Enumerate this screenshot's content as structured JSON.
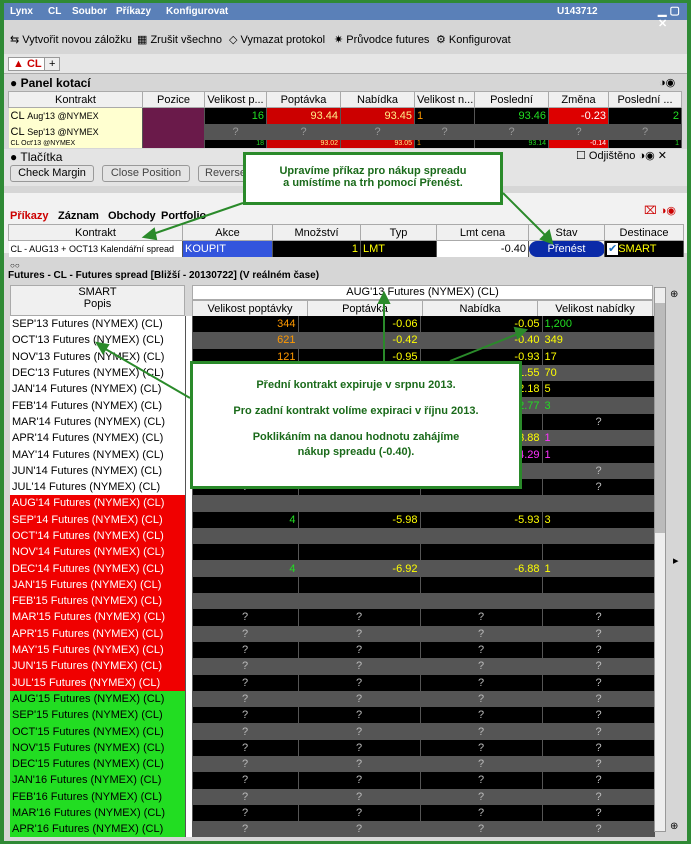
{
  "title": {
    "app": "Lynx",
    "symbol": "CL",
    "menus": [
      "Soubor",
      "Příkazy",
      "Konfigurovat"
    ],
    "account": "U143712"
  },
  "toolbar": [
    "Vytvořit novou záložku",
    "Zrušit všechno",
    "Vymazat protokol",
    "Průvodce futures",
    "Konfigurovat"
  ],
  "tabs": {
    "active": "CL",
    "add": "+"
  },
  "quote_panel": {
    "title": "Panel kotací",
    "headers": [
      "Kontrakt",
      "Pozice",
      "Velikost p...",
      "Poptávka",
      "Nabídka",
      "Velikost n...",
      "Poslední",
      "Změna",
      "Poslední ..."
    ],
    "rows": [
      {
        "contract": "CL",
        "detail": "Aug'13 @NYMEX",
        "bid_size": "16",
        "bid": "93.44",
        "ask": "93.45",
        "ask_size": "1",
        "last": "93.46",
        "change": "-0.23",
        "last_size": "2"
      },
      {
        "contract": "CL",
        "detail": "Sep'13 @NYMEX",
        "bid_size": "?",
        "bid": "?",
        "ask": "?",
        "ask_size": "?",
        "last": "?",
        "change": "?",
        "last_size": "?"
      },
      {
        "contract": "CL",
        "detail": "Oct'13 @NYMEX",
        "bid_size": "18",
        "bid": "93.02",
        "ask": "93.05",
        "ask_size": "1",
        "last": "93.14",
        "change": "-0.14",
        "last_size": "1"
      }
    ]
  },
  "buttons_panel": {
    "title": "Tlačítka",
    "unlocked": "Odjištěno",
    "buttons": [
      "Check Margin",
      "Close Position",
      "Reverse"
    ]
  },
  "orders": {
    "tabs": [
      "Příkazy",
      "Záznam",
      "Obchody",
      "Portfolio"
    ],
    "headers": [
      "Kontrakt",
      "Akce",
      "Množství",
      "Typ",
      "Lmt cena",
      "Stav",
      "Destinace"
    ],
    "row": {
      "contract": "CL - AUG13 + OCT13 Kalendářní spread",
      "action": "KOUPIT",
      "qty": "1",
      "type": "LMT",
      "price": "-0.40",
      "status": "Přenést",
      "dest": "SMART"
    }
  },
  "futures": {
    "title": "Futures - CL - Futures spread [Bližší - 20130722] (V reálném čase)",
    "exchange": "SMART",
    "popis": "Popis",
    "front": "AUG'13 Futures (NYMEX) (CL)",
    "headers": [
      "Velikost poptávky",
      "Poptávka",
      "Nabídka",
      "Velikost nabídky"
    ],
    "rows": [
      {
        "name": "SEP'13 Futures (NYMEX) (CL)",
        "c": "w",
        "bs": "344",
        "b": "-0.06",
        "a": "-0.05",
        "as": "1,200"
      },
      {
        "name": "OCT'13 Futures (NYMEX) (CL)",
        "c": "w",
        "bs": "621",
        "b": "-0.42",
        "a": "-0.40",
        "as": "349"
      },
      {
        "name": "NOV'13 Futures (NYMEX) (CL)",
        "c": "w",
        "bs": "121",
        "b": "-0.95",
        "a": "-0.93",
        "as": "17"
      },
      {
        "name": "DEC'13 Futures (NYMEX) (CL)",
        "c": "w",
        "bs": "",
        "b": "",
        "a": "-1.55",
        "as": "70"
      },
      {
        "name": "JAN'14 Futures (NYMEX) (CL)",
        "c": "w",
        "bs": "",
        "b": "",
        "a": "-2.18",
        "as": "5"
      },
      {
        "name": "FEB'14 Futures (NYMEX) (CL)",
        "c": "w",
        "bs": "",
        "b": "",
        "a": "-2.77",
        "as": "3"
      },
      {
        "name": "MAR'14 Futures (NYMEX) (CL)",
        "c": "w",
        "bs": "",
        "b": "",
        "a": "",
        "as": "?"
      },
      {
        "name": "APR'14 Futures (NYMEX) (CL)",
        "c": "w",
        "bs": "",
        "b": "",
        "a": "-3.88",
        "as": "1"
      },
      {
        "name": "MAY'14 Futures (NYMEX) (CL)",
        "c": "w",
        "bs": "",
        "b": "",
        "a": "-4.29",
        "as": "1"
      },
      {
        "name": "JUN'14 Futures (NYMEX) (CL)",
        "c": "w",
        "bs": "",
        "b": "",
        "a": "",
        "as": "?"
      },
      {
        "name": "JUL'14 Futures (NYMEX) (CL)",
        "c": "w",
        "bs": "?",
        "b": "",
        "a": "",
        "as": "?"
      },
      {
        "name": "AUG'14 Futures (NYMEX) (CL)",
        "c": "r",
        "bs": "",
        "b": "",
        "a": "",
        "as": ""
      },
      {
        "name": "SEP'14 Futures (NYMEX) (CL)",
        "c": "r",
        "bs": "4",
        "b": "-5.98",
        "a": "-5.93",
        "as": "3"
      },
      {
        "name": "OCT'14 Futures (NYMEX) (CL)",
        "c": "r",
        "bs": "",
        "b": "",
        "a": "",
        "as": ""
      },
      {
        "name": "NOV'14 Futures (NYMEX) (CL)",
        "c": "r",
        "bs": "",
        "b": "",
        "a": "",
        "as": ""
      },
      {
        "name": "DEC'14 Futures (NYMEX) (CL)",
        "c": "r",
        "bs": "4",
        "b": "-6.92",
        "a": "-6.88",
        "as": "1"
      },
      {
        "name": "JAN'15 Futures (NYMEX) (CL)",
        "c": "r",
        "bs": "",
        "b": "",
        "a": "",
        "as": ""
      },
      {
        "name": "FEB'15 Futures (NYMEX) (CL)",
        "c": "r",
        "bs": "",
        "b": "",
        "a": "",
        "as": ""
      },
      {
        "name": "MAR'15 Futures (NYMEX) (CL)",
        "c": "r",
        "bs": "?",
        "b": "?",
        "a": "?",
        "as": "?"
      },
      {
        "name": "APR'15 Futures (NYMEX) (CL)",
        "c": "r",
        "bs": "?",
        "b": "?",
        "a": "?",
        "as": "?"
      },
      {
        "name": "MAY'15 Futures (NYMEX) (CL)",
        "c": "r",
        "bs": "?",
        "b": "?",
        "a": "?",
        "as": "?"
      },
      {
        "name": "JUN'15 Futures (NYMEX) (CL)",
        "c": "r",
        "bs": "?",
        "b": "?",
        "a": "?",
        "as": "?"
      },
      {
        "name": "JUL'15 Futures (NYMEX) (CL)",
        "c": "r",
        "bs": "?",
        "b": "?",
        "a": "?",
        "as": "?"
      },
      {
        "name": "AUG'15 Futures (NYMEX) (CL)",
        "c": "g",
        "bs": "?",
        "b": "?",
        "a": "?",
        "as": "?"
      },
      {
        "name": "SEP'15 Futures (NYMEX) (CL)",
        "c": "g",
        "bs": "?",
        "b": "?",
        "a": "?",
        "as": "?"
      },
      {
        "name": "OCT'15 Futures (NYMEX) (CL)",
        "c": "g",
        "bs": "?",
        "b": "?",
        "a": "?",
        "as": "?"
      },
      {
        "name": "NOV'15 Futures (NYMEX) (CL)",
        "c": "g",
        "bs": "?",
        "b": "?",
        "a": "?",
        "as": "?"
      },
      {
        "name": "DEC'15 Futures (NYMEX) (CL)",
        "c": "g",
        "bs": "?",
        "b": "?",
        "a": "?",
        "as": "?"
      },
      {
        "name": "JAN'16 Futures (NYMEX) (CL)",
        "c": "g",
        "bs": "?",
        "b": "?",
        "a": "?",
        "as": "?"
      },
      {
        "name": "FEB'16 Futures (NYMEX) (CL)",
        "c": "g",
        "bs": "?",
        "b": "?",
        "a": "?",
        "as": "?"
      },
      {
        "name": "MAR'16 Futures (NYMEX) (CL)",
        "c": "g",
        "bs": "?",
        "b": "?",
        "a": "?",
        "as": "?"
      },
      {
        "name": "APR'16 Futures (NYMEX) (CL)",
        "c": "g",
        "bs": "?",
        "b": "?",
        "a": "?",
        "as": "?"
      }
    ]
  },
  "callouts": {
    "top": [
      "Upravíme příkaz pro nákup spreadu",
      "a umístíme na trh pomocí Přenést."
    ],
    "mid": [
      "Přední kontrakt expiruje v srpnu 2013.",
      "Pro zadní kontrakt volíme expiraci v říjnu 2013.",
      "Poklikáním na danou hodnotu zahájíme",
      "nákup spreadu (-0.40)."
    ]
  },
  "colors": {
    "red": "#f00000",
    "green": "#22dd22",
    "orange": "#ff9900",
    "yellow": "#ffff00",
    "magenta": "#ff33ff",
    "callout": "#2a8a2a"
  }
}
